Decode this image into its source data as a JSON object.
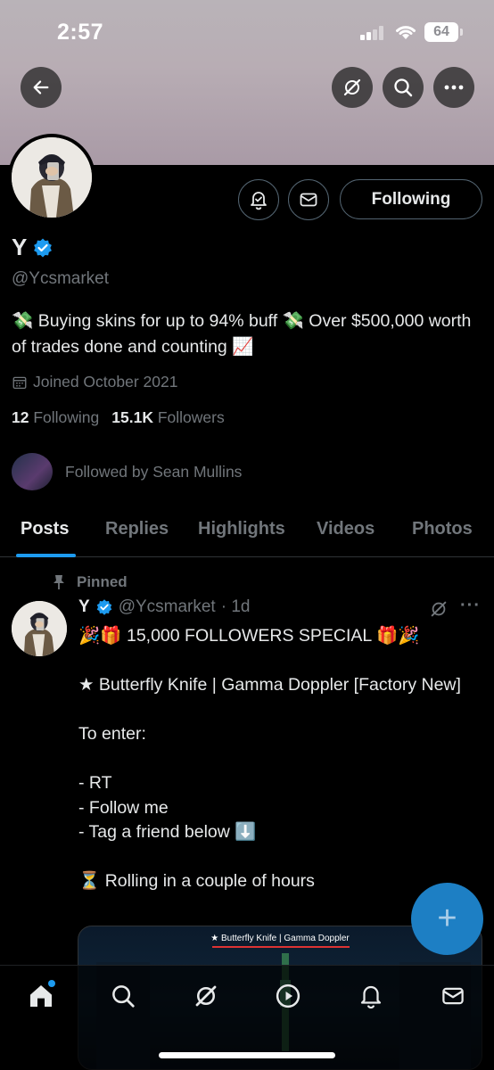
{
  "status_bar": {
    "time": "2:57",
    "battery": "64"
  },
  "profile": {
    "name": "Y",
    "handle": "@Ycsmarket",
    "bio": "💸 Buying skins for up to 94% buff 💸 Over $500,000 worth of trades done and counting 📈",
    "joined": "Joined October 2021",
    "following_count": "12",
    "following_label": "Following",
    "followers_count": "15.1K",
    "followers_label": "Followers",
    "followed_by": "Followed by Sean Mullins",
    "follow_button": "Following"
  },
  "tabs": [
    {
      "label": "Posts"
    },
    {
      "label": "Replies"
    },
    {
      "label": "Highlights"
    },
    {
      "label": "Videos"
    },
    {
      "label": "Photos"
    }
  ],
  "post": {
    "pinned_label": "Pinned",
    "author_name": "Y",
    "author_handle": "@Ycsmarket",
    "time": "· 1d",
    "lines": [
      "🎉🎁 15,000 FOLLOWERS SPECIAL 🎁🎉",
      "",
      "★ Butterfly Knife | Gamma Doppler [Factory New]",
      "",
      "To enter:",
      "",
      "- RT",
      "- Follow me",
      "- Tag a friend below ⬇️",
      "",
      "⏳ Rolling in a couple of hours"
    ],
    "media_caption": "★ Butterfly Knife | Gamma Doppler"
  },
  "fab_label": "+",
  "icons": {
    "back": "back-arrow-icon",
    "grok": "grok-icon",
    "search": "search-icon",
    "more": "more-icon",
    "notify": "notification-bell-icon",
    "message": "mail-icon",
    "verified": "verified-badge-icon",
    "calendar": "calendar-icon",
    "pin": "pin-icon"
  },
  "colors": {
    "accent": "#1d9bf0",
    "background": "#000000",
    "muted": "#71767b"
  }
}
